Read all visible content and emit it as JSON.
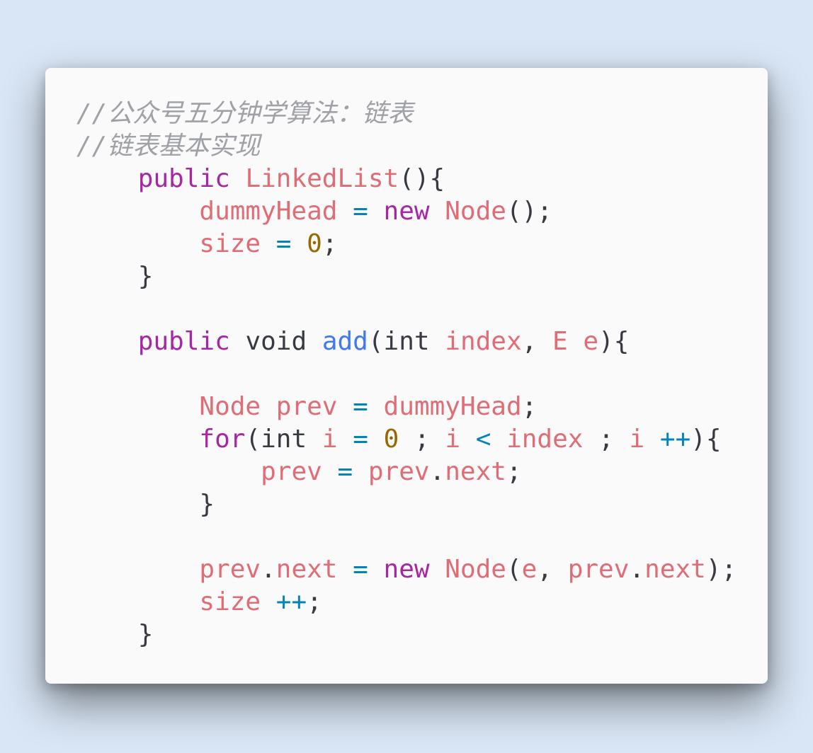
{
  "colors": {
    "background": "#d9e6f5",
    "card": "#fafafa",
    "comment": "#a0a1a7",
    "keyword": "#a626a4",
    "function": "#4078f2",
    "variable": "#e06c75",
    "operator": "#0184bc",
    "number": "#986801",
    "plain": "#383a42"
  },
  "code": {
    "comment1": "//公众号五分钟学算法：链表",
    "comment2": "//链表基本实现",
    "kw_public": "public",
    "kw_void": "void",
    "kw_new": "new",
    "kw_int": "int",
    "kw_for": "for",
    "ctor_name": "LinkedList",
    "method_add": "add",
    "var_dummyHead": "dummyHead",
    "var_size": "size",
    "var_index": "index",
    "var_E": "E",
    "var_e": "e",
    "var_prev": "prev",
    "var_next": "next",
    "var_i": "i",
    "cls_Node": "Node",
    "op_assign": "=",
    "op_lt": "<",
    "op_inc": "++",
    "num_zero": "0"
  }
}
